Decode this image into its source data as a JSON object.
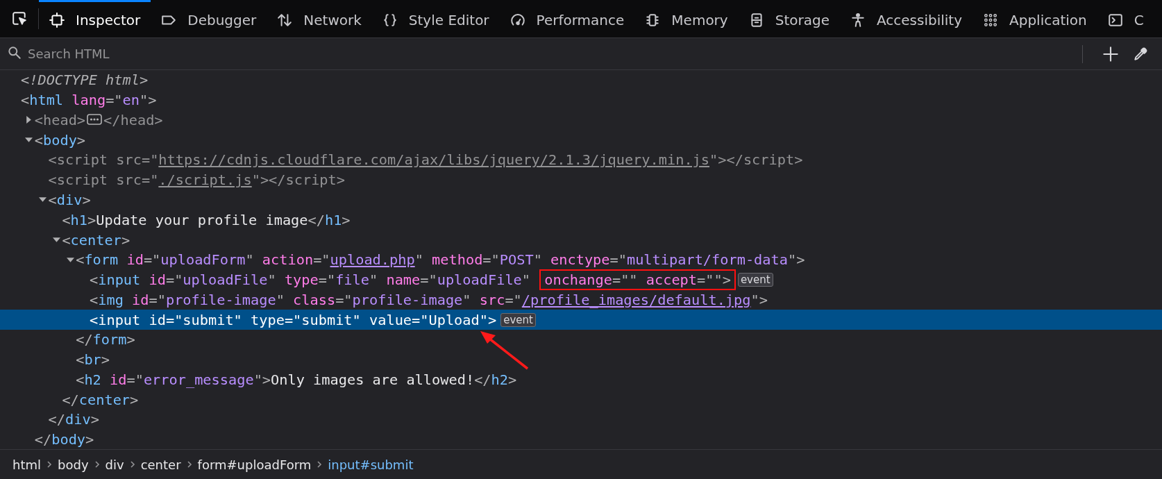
{
  "tabs": [
    {
      "label": "Inspector",
      "selected": true
    },
    {
      "label": "Debugger",
      "selected": false
    },
    {
      "label": "Network",
      "selected": false
    },
    {
      "label": "Style Editor",
      "selected": false
    },
    {
      "label": "Performance",
      "selected": false
    },
    {
      "label": "Memory",
      "selected": false
    },
    {
      "label": "Storage",
      "selected": false
    },
    {
      "label": "Accessibility",
      "selected": false
    },
    {
      "label": "Application",
      "selected": false
    },
    {
      "label": "C",
      "selected": false
    }
  ],
  "search": {
    "placeholder": "Search HTML"
  },
  "tree": [
    {
      "selected": false,
      "open": [
        {
          "kind": "doctype",
          "text": "<!DOCTYPE html>"
        }
      ]
    },
    {
      "selected": false,
      "open": [
        {
          "kind": "p",
          "text": "<"
        },
        {
          "kind": "tag",
          "text": "html"
        },
        {
          "kind": "attr",
          "text": " lang"
        },
        {
          "kind": "p",
          "text": "=\""
        },
        {
          "kind": "value",
          "text": "en"
        },
        {
          "kind": "p",
          "text": "\">"
        }
      ],
      "children": [
        {
          "selected": false,
          "dimmed": true,
          "expanded": false,
          "open": [
            {
              "kind": "p",
              "text": "<"
            },
            {
              "kind": "tag",
              "text": "head"
            },
            {
              "kind": "p",
              "text": ">"
            }
          ],
          "close": [
            {
              "kind": "p",
              "text": "</"
            },
            {
              "kind": "tag",
              "text": "head"
            },
            {
              "kind": "p",
              "text": ">"
            }
          ]
        },
        {
          "selected": false,
          "expanded": true,
          "open": [
            {
              "kind": "p",
              "text": "<"
            },
            {
              "kind": "tag",
              "text": "body"
            },
            {
              "kind": "p",
              "text": ">"
            }
          ],
          "close": [
            {
              "kind": "p",
              "text": "</"
            },
            {
              "kind": "tag",
              "text": "body"
            },
            {
              "kind": "p",
              "text": ">"
            }
          ],
          "children": [
            {
              "selected": false,
              "dimmed": true,
              "open": [
                {
                  "kind": "p",
                  "text": "<"
                },
                {
                  "kind": "tag",
                  "text": "script"
                },
                {
                  "kind": "attr",
                  "text": " src"
                },
                {
                  "kind": "p",
                  "text": "=\""
                },
                {
                  "kind": "link",
                  "text": "https://cdnjs.cloudflare.com/ajax/libs/jquery/2.1.3/jquery.min.js"
                },
                {
                  "kind": "p",
                  "text": "\">"
                },
                {
                  "kind": "p",
                  "text": "</"
                },
                {
                  "kind": "tag",
                  "text": "script"
                },
                {
                  "kind": "p",
                  "text": ">"
                }
              ]
            },
            {
              "selected": false,
              "dimmed": true,
              "open": [
                {
                  "kind": "p",
                  "text": "<"
                },
                {
                  "kind": "tag",
                  "text": "script"
                },
                {
                  "kind": "attr",
                  "text": " src"
                },
                {
                  "kind": "p",
                  "text": "=\""
                },
                {
                  "kind": "link",
                  "text": "./script.js"
                },
                {
                  "kind": "p",
                  "text": "\">"
                },
                {
                  "kind": "p",
                  "text": "</"
                },
                {
                  "kind": "tag",
                  "text": "script"
                },
                {
                  "kind": "p",
                  "text": ">"
                }
              ]
            },
            {
              "selected": false,
              "expanded": true,
              "open": [
                {
                  "kind": "p",
                  "text": "<"
                },
                {
                  "kind": "tag",
                  "text": "div"
                },
                {
                  "kind": "p",
                  "text": ">"
                }
              ],
              "close": [
                {
                  "kind": "p",
                  "text": "</"
                },
                {
                  "kind": "tag",
                  "text": "div"
                },
                {
                  "kind": "p",
                  "text": ">"
                }
              ],
              "children": [
                {
                  "selected": false,
                  "open": [
                    {
                      "kind": "p",
                      "text": "<"
                    },
                    {
                      "kind": "tag",
                      "text": "h1"
                    },
                    {
                      "kind": "p",
                      "text": ">"
                    },
                    {
                      "kind": "text",
                      "text": "Update your profile image"
                    },
                    {
                      "kind": "p",
                      "text": "</"
                    },
                    {
                      "kind": "tag",
                      "text": "h1"
                    },
                    {
                      "kind": "p",
                      "text": ">"
                    }
                  ]
                },
                {
                  "selected": false,
                  "expanded": true,
                  "open": [
                    {
                      "kind": "p",
                      "text": "<"
                    },
                    {
                      "kind": "tag",
                      "text": "center"
                    },
                    {
                      "kind": "p",
                      "text": ">"
                    }
                  ],
                  "close": [
                    {
                      "kind": "p",
                      "text": "</"
                    },
                    {
                      "kind": "tag",
                      "text": "center"
                    },
                    {
                      "kind": "p",
                      "text": ">"
                    }
                  ],
                  "children": [
                    {
                      "selected": false,
                      "expanded": true,
                      "open": [
                        {
                          "kind": "p",
                          "text": "<"
                        },
                        {
                          "kind": "tag",
                          "text": "form"
                        },
                        {
                          "kind": "attr",
                          "text": " id"
                        },
                        {
                          "kind": "p",
                          "text": "=\""
                        },
                        {
                          "kind": "value",
                          "text": "uploadForm"
                        },
                        {
                          "kind": "p",
                          "text": "\""
                        },
                        {
                          "kind": "attr",
                          "text": " action"
                        },
                        {
                          "kind": "p",
                          "text": "=\""
                        },
                        {
                          "kind": "link",
                          "text": "upload.php"
                        },
                        {
                          "kind": "p",
                          "text": "\""
                        },
                        {
                          "kind": "attr",
                          "text": " method"
                        },
                        {
                          "kind": "p",
                          "text": "=\""
                        },
                        {
                          "kind": "value",
                          "text": "POST"
                        },
                        {
                          "kind": "p",
                          "text": "\""
                        },
                        {
                          "kind": "attr",
                          "text": " enctype"
                        },
                        {
                          "kind": "p",
                          "text": "=\""
                        },
                        {
                          "kind": "value",
                          "text": "multipart/form-data"
                        },
                        {
                          "kind": "p",
                          "text": "\">"
                        }
                      ],
                      "close": [
                        {
                          "kind": "p",
                          "text": "</"
                        },
                        {
                          "kind": "tag",
                          "text": "form"
                        },
                        {
                          "kind": "p",
                          "text": ">"
                        }
                      ],
                      "children": [
                        {
                          "selected": false,
                          "badge": "event",
                          "open": [
                            {
                              "kind": "p",
                              "text": "<"
                            },
                            {
                              "kind": "tag",
                              "text": "input"
                            },
                            {
                              "kind": "attr",
                              "text": " id"
                            },
                            {
                              "kind": "p",
                              "text": "=\""
                            },
                            {
                              "kind": "value",
                              "text": "uploadFile"
                            },
                            {
                              "kind": "p",
                              "text": "\""
                            },
                            {
                              "kind": "attr",
                              "text": " type"
                            },
                            {
                              "kind": "p",
                              "text": "=\""
                            },
                            {
                              "kind": "value",
                              "text": "file"
                            },
                            {
                              "kind": "p",
                              "text": "\""
                            },
                            {
                              "kind": "attr",
                              "text": " name"
                            },
                            {
                              "kind": "p",
                              "text": "=\""
                            },
                            {
                              "kind": "value",
                              "text": "uploadFile"
                            },
                            {
                              "kind": "p",
                              "text": "\" "
                            },
                            {
                              "kind": "boxed",
                              "parts": [
                                {
                                  "kind": "attr",
                                  "text": "onchange"
                                },
                                {
                                  "kind": "p",
                                  "text": "=\"\""
                                },
                                {
                                  "kind": "attr",
                                  "text": " accept"
                                },
                                {
                                  "kind": "p",
                                  "text": "=\"\">"
                                }
                              ]
                            }
                          ]
                        },
                        {
                          "selected": false,
                          "open": [
                            {
                              "kind": "p",
                              "text": "<"
                            },
                            {
                              "kind": "tag",
                              "text": "img"
                            },
                            {
                              "kind": "attr",
                              "text": " id"
                            },
                            {
                              "kind": "p",
                              "text": "=\""
                            },
                            {
                              "kind": "value",
                              "text": "profile-image"
                            },
                            {
                              "kind": "p",
                              "text": "\""
                            },
                            {
                              "kind": "attr",
                              "text": " class"
                            },
                            {
                              "kind": "p",
                              "text": "=\""
                            },
                            {
                              "kind": "value",
                              "text": "profile-image"
                            },
                            {
                              "kind": "p",
                              "text": "\""
                            },
                            {
                              "kind": "attr",
                              "text": " src"
                            },
                            {
                              "kind": "p",
                              "text": "=\""
                            },
                            {
                              "kind": "link",
                              "text": "/profile_images/default.jpg"
                            },
                            {
                              "kind": "p",
                              "text": "\">"
                            }
                          ]
                        },
                        {
                          "selected": true,
                          "badge": "event",
                          "open": [
                            {
                              "kind": "p",
                              "text": "<"
                            },
                            {
                              "kind": "tag",
                              "text": "input"
                            },
                            {
                              "kind": "attr",
                              "text": " id"
                            },
                            {
                              "kind": "p",
                              "text": "=\""
                            },
                            {
                              "kind": "value",
                              "text": "submit"
                            },
                            {
                              "kind": "p",
                              "text": "\""
                            },
                            {
                              "kind": "attr",
                              "text": " type"
                            },
                            {
                              "kind": "p",
                              "text": "=\""
                            },
                            {
                              "kind": "value",
                              "text": "submit"
                            },
                            {
                              "kind": "p",
                              "text": "\""
                            },
                            {
                              "kind": "attr",
                              "text": " value"
                            },
                            {
                              "kind": "p",
                              "text": "=\""
                            },
                            {
                              "kind": "value",
                              "text": "Upload"
                            },
                            {
                              "kind": "p",
                              "text": "\">"
                            }
                          ]
                        }
                      ]
                    },
                    {
                      "selected": false,
                      "open": [
                        {
                          "kind": "p",
                          "text": "<"
                        },
                        {
                          "kind": "tag",
                          "text": "br"
                        },
                        {
                          "kind": "p",
                          "text": ">"
                        }
                      ]
                    },
                    {
                      "selected": false,
                      "open": [
                        {
                          "kind": "p",
                          "text": "<"
                        },
                        {
                          "kind": "tag",
                          "text": "h2"
                        },
                        {
                          "kind": "attr",
                          "text": " id"
                        },
                        {
                          "kind": "p",
                          "text": "=\""
                        },
                        {
                          "kind": "value",
                          "text": "error_message"
                        },
                        {
                          "kind": "p",
                          "text": "\">"
                        },
                        {
                          "kind": "text",
                          "text": "Only images are allowed!"
                        },
                        {
                          "kind": "p",
                          "text": "</"
                        },
                        {
                          "kind": "tag",
                          "text": "h2"
                        },
                        {
                          "kind": "p",
                          "text": ">"
                        }
                      ]
                    }
                  ]
                }
              ]
            }
          ]
        }
      ]
    }
  ],
  "breadcrumbs": [
    {
      "label": "html",
      "selected": false
    },
    {
      "label": "body",
      "selected": false
    },
    {
      "label": "div",
      "selected": false
    },
    {
      "label": "center",
      "selected": false
    },
    {
      "label": "form#uploadForm",
      "selected": false
    },
    {
      "label": "input#submit",
      "selected": true
    }
  ]
}
